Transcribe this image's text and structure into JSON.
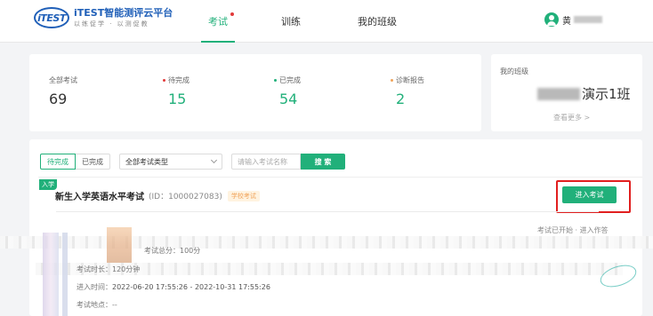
{
  "header": {
    "logo_mark": "iTEST",
    "logo_title": "iTEST智能测评云平台",
    "logo_subtitle": "以练促学 · 以测促教",
    "nav": [
      {
        "label": "考试",
        "active": true
      },
      {
        "label": "训练",
        "active": false
      },
      {
        "label": "我的班级",
        "active": false
      }
    ],
    "user_name": "黄"
  },
  "stats": {
    "items": [
      {
        "label": "全部考试",
        "value": "69",
        "color": "#333333",
        "dot": ""
      },
      {
        "label": "待完成",
        "value": "15",
        "color": "#21b07a",
        "dot": "#e23a3a"
      },
      {
        "label": "已完成",
        "value": "54",
        "color": "#21b07a",
        "dot": "#21b07a"
      },
      {
        "label": "诊断报告",
        "value": "2",
        "color": "#21b07a",
        "dot": "#f0a35a"
      }
    ]
  },
  "class_card": {
    "label": "我的班级",
    "name_suffix": "演示1班",
    "more": "查看更多 >"
  },
  "filters": {
    "pending": "待完成",
    "done": "已完成",
    "type_select": "全部考试类型",
    "search_placeholder": "请输入考试名称",
    "search_button": "搜 索"
  },
  "exam": {
    "corner_tag": "入学",
    "title": "新生入学英语水平考试",
    "id_text": "(ID：1000027083)",
    "badge": "学校考试",
    "enter_button": "进入考试",
    "status": "考试已开始  · 进入作答",
    "details": {
      "total_score": "考试总分：100分",
      "duration": "考试时长：120分钟",
      "entry_time_label": "进入时间：",
      "entry_time_value": "2022-06-20 17:55:26 - 2022-10-31 17:55:26",
      "location": "考试地点：--"
    }
  },
  "colors": {
    "accent": "#21b07a",
    "highlight": "#e11f1f",
    "brand": "#1f5fb8"
  }
}
